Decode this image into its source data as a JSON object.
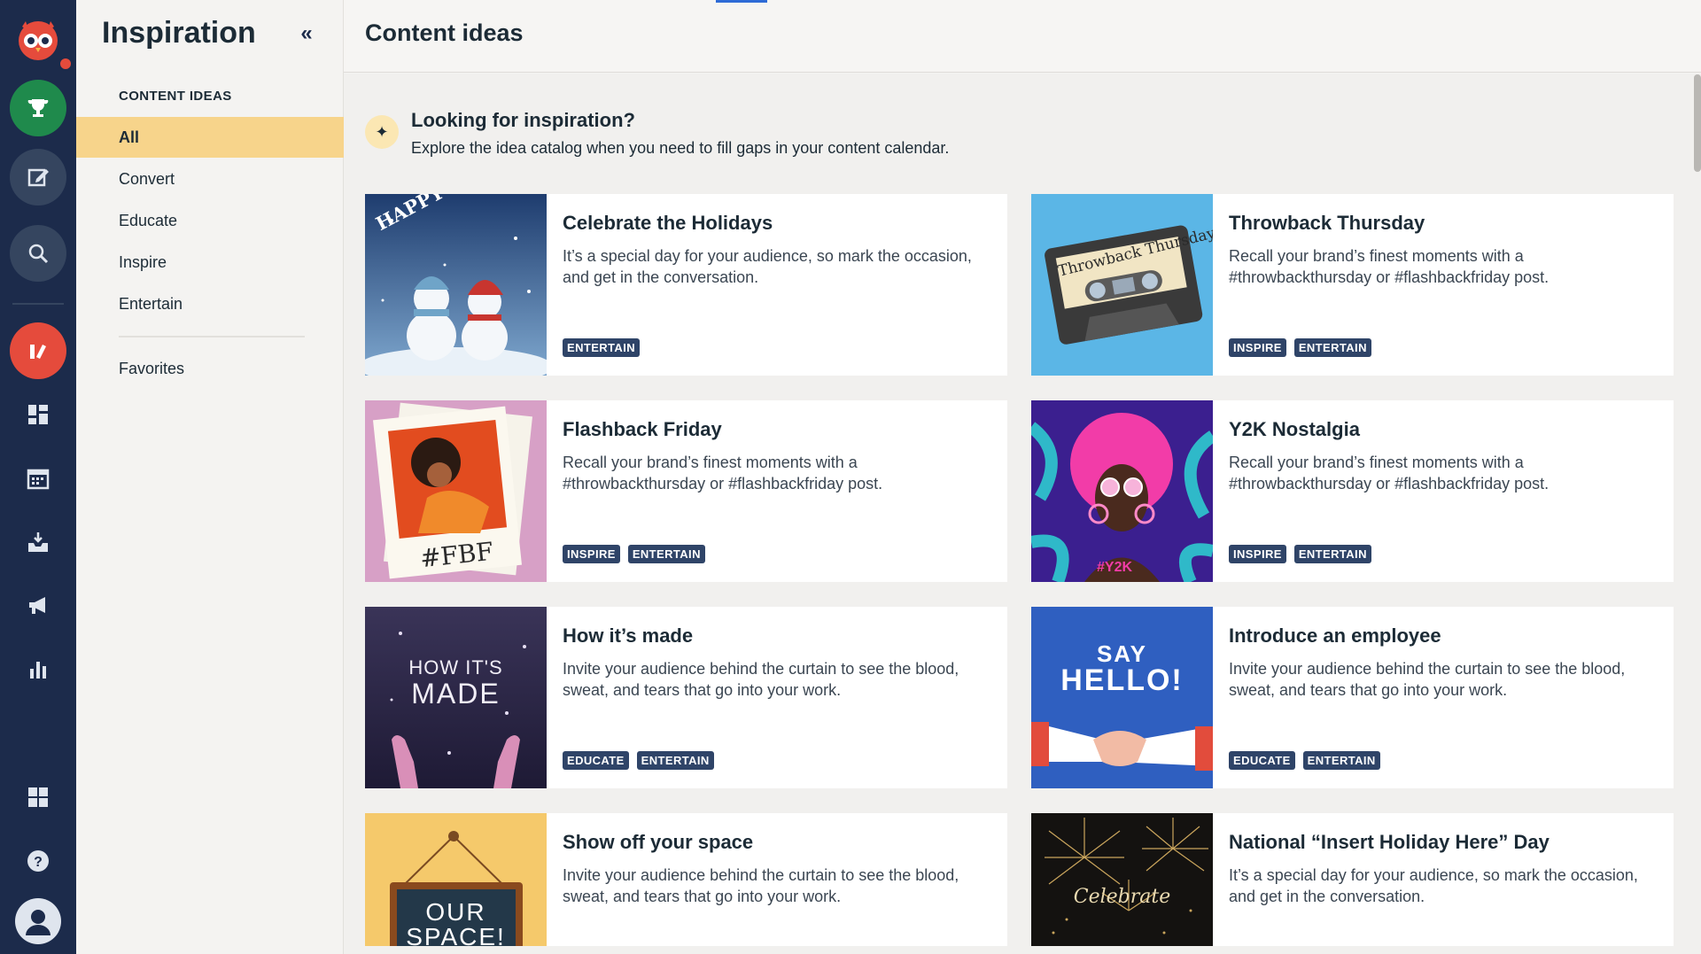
{
  "rail": {
    "items": [
      {
        "name": "owl-logo-icon"
      },
      {
        "name": "trophy-icon"
      },
      {
        "name": "compose-icon"
      },
      {
        "name": "search-icon"
      },
      {
        "name": "inspiration-icon"
      },
      {
        "name": "dashboard-icon"
      },
      {
        "name": "calendar-icon"
      },
      {
        "name": "inbox-icon"
      },
      {
        "name": "megaphone-icon"
      },
      {
        "name": "analytics-icon"
      },
      {
        "name": "apps-icon"
      },
      {
        "name": "help-icon"
      },
      {
        "name": "profile-icon"
      }
    ]
  },
  "sidebar": {
    "title": "Inspiration",
    "collapse_icon": "«",
    "section_label": "CONTENT IDEAS",
    "items": [
      "All",
      "Convert",
      "Educate",
      "Inspire",
      "Entertain"
    ],
    "favorites": "Favorites"
  },
  "header": {
    "title": "Content ideas"
  },
  "banner": {
    "icon": "✦",
    "title": "Looking for inspiration?",
    "subtitle": "Explore the idea catalog when you need to fill gaps in your content calendar."
  },
  "cards": [
    {
      "title": "Celebrate the Holidays",
      "desc": "It’s a special day for your audience, so mark the occasion, and get in the conversation.",
      "tags": [
        "ENTERTAIN"
      ],
      "thumb_text": "HAPPY HOLIDAYS"
    },
    {
      "title": "Throwback Thursday",
      "desc": "Recall your brand’s finest moments with a #throwbackthursday or #flashbackfriday post.",
      "tags": [
        "INSPIRE",
        "ENTERTAIN"
      ],
      "thumb_text": "Throwback Thursday"
    },
    {
      "title": "Flashback Friday",
      "desc": "Recall your brand’s finest moments with a #throwbackthursday or #flashbackfriday post.",
      "tags": [
        "INSPIRE",
        "ENTERTAIN"
      ],
      "thumb_text": "#FBF"
    },
    {
      "title": "Y2K Nostalgia",
      "desc": "Recall your brand’s finest moments with a #throwbackthursday or #flashbackfriday post.",
      "tags": [
        "INSPIRE",
        "ENTERTAIN"
      ],
      "thumb_text": "#Y2K"
    },
    {
      "title": "How it’s made",
      "desc": "Invite your audience behind the curtain to see the blood, sweat, and tears that go into your work.",
      "tags": [
        "EDUCATE",
        "ENTERTAIN"
      ],
      "thumb_text": "HOW IT'S",
      "thumb_text2": "MADE"
    },
    {
      "title": "Introduce an employee",
      "desc": "Invite your audience behind the curtain to see the blood, sweat, and tears that go into your work.",
      "tags": [
        "EDUCATE",
        "ENTERTAIN"
      ],
      "thumb_text": "SAY",
      "thumb_text2": "HELLO!"
    },
    {
      "title": "Show off your space",
      "desc": "Invite your audience behind the curtain to see the blood, sweat, and tears that go into your work.",
      "tags": [],
      "thumb_text": "OUR",
      "thumb_text2": "SPACE!"
    },
    {
      "title": "National “Insert Holiday Here” Day",
      "desc": "It’s a special day for your audience, so mark the occasion, and get in the conversation.",
      "tags": [],
      "thumb_text": "Celebrate"
    }
  ]
}
